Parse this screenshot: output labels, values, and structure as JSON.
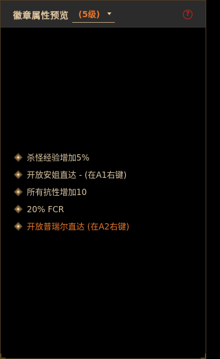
{
  "header": {
    "title": "徽章属性预览",
    "level_select": {
      "selected": "(5级)"
    },
    "help_icon": "question-circle-icon",
    "help_glyph": "?"
  },
  "attributes": [
    {
      "text": "杀怪经验增加5%",
      "color": "#d7c3a0"
    },
    {
      "text": "开放安姐直达 - (在A1右键)",
      "color": "#d7c3a0"
    },
    {
      "text": "所有抗性增加10",
      "color": "#d7c3a0"
    },
    {
      "text": "20% FCR",
      "color": "#d7c3a0"
    },
    {
      "text": "开放普瑞尔直达 (在A2右键)",
      "color": "#e8762a"
    }
  ],
  "colors": {
    "accent": "#e8762a",
    "text": "#d7c3a0",
    "help": "#c0231b",
    "header_bg": "#2b2b2b",
    "panel_bg": "#000000"
  }
}
